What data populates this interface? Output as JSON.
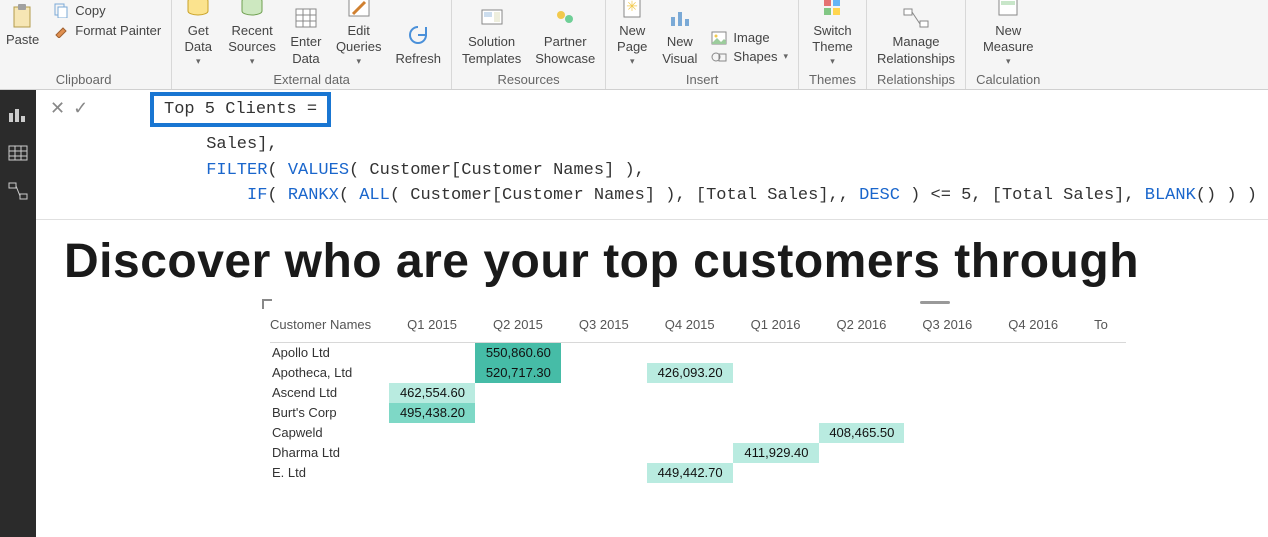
{
  "ribbon": {
    "paste": "Paste",
    "copy": "Copy",
    "format_painter": "Format Painter",
    "clipboard_label": "Clipboard",
    "get_data": "Get\nData",
    "recent_sources": "Recent\nSources",
    "enter_data": "Enter\nData",
    "edit_queries": "Edit\nQueries",
    "refresh": "Refresh",
    "external_data_label": "External data",
    "solution_templates": "Solution\nTemplates",
    "partner_showcase": "Partner\nShowcase",
    "resources_label": "Resources",
    "new_page": "New\nPage",
    "new_visual": "New\nVisual",
    "image": "Image",
    "shapes": "Shapes",
    "insert_label": "Insert",
    "switch_theme": "Switch\nTheme",
    "themes_label": "Themes",
    "manage_relationships": "Manage\nRelationships",
    "relationships_label": "Relationships",
    "new_measure": "New\nMeasure",
    "calculations_label": "Calculation"
  },
  "formula": {
    "measure_name": "Top 5 Clients =",
    "line1_suffix": "Sales],",
    "line2_a": "FILTER",
    "line2_b": "( ",
    "line2_c": "VALUES",
    "line2_d": "( Customer[Customer Names] ),",
    "line3_a": "IF",
    "line3_b": "( ",
    "line3_c": "RANKX",
    "line3_d": "( ",
    "line3_e": "ALL",
    "line3_f": "( Customer[Customer Names] ), [Total Sales],, ",
    "line3_g": "DESC",
    "line3_h": " ) <= 5, [Total Sales], ",
    "line3_i": "BLANK",
    "line3_j": "() ) ) )"
  },
  "headline": "Discover who are your top customers through",
  "matrix": {
    "row_header": "Customer Names",
    "columns": [
      "Q1 2015",
      "Q2 2015",
      "Q3 2015",
      "Q4 2015",
      "Q1 2016",
      "Q2 2016",
      "Q3 2016",
      "Q4 2016",
      "To"
    ],
    "rows": [
      {
        "name": "Apollo Ltd",
        "cells": [
          "",
          "550,860.60",
          "",
          "",
          "",
          "",
          "",
          "",
          ""
        ],
        "hl": [
          null,
          "dark",
          null,
          null,
          null,
          null,
          null,
          null,
          null
        ]
      },
      {
        "name": "Apotheca, Ltd",
        "cells": [
          "",
          "520,717.30",
          "",
          "426,093.20",
          "",
          "",
          "",
          "",
          ""
        ],
        "hl": [
          null,
          "dark",
          null,
          "light",
          null,
          null,
          null,
          null,
          null
        ]
      },
      {
        "name": "Ascend Ltd",
        "cells": [
          "462,554.60",
          "",
          "",
          "",
          "",
          "",
          "",
          "",
          ""
        ],
        "hl": [
          "light",
          null,
          null,
          null,
          null,
          null,
          null,
          null,
          null
        ]
      },
      {
        "name": "Burt's Corp",
        "cells": [
          "495,438.20",
          "",
          "",
          "",
          "",
          "",
          "",
          "",
          ""
        ],
        "hl": [
          "mid",
          null,
          null,
          null,
          null,
          null,
          null,
          null,
          null
        ]
      },
      {
        "name": "Capweld",
        "cells": [
          "",
          "",
          "",
          "",
          "",
          "408,465.50",
          "",
          "",
          ""
        ],
        "hl": [
          null,
          null,
          null,
          null,
          null,
          "light",
          null,
          null,
          null
        ]
      },
      {
        "name": "Dharma Ltd",
        "cells": [
          "",
          "",
          "",
          "",
          "411,929.40",
          "",
          "",
          "",
          ""
        ],
        "hl": [
          null,
          null,
          null,
          null,
          "light",
          null,
          null,
          null,
          null
        ]
      },
      {
        "name": "E. Ltd",
        "cells": [
          "",
          "",
          "",
          "449,442.70",
          "",
          "",
          "",
          "",
          ""
        ],
        "hl": [
          null,
          null,
          null,
          "light",
          null,
          null,
          null,
          null,
          null
        ]
      }
    ]
  }
}
